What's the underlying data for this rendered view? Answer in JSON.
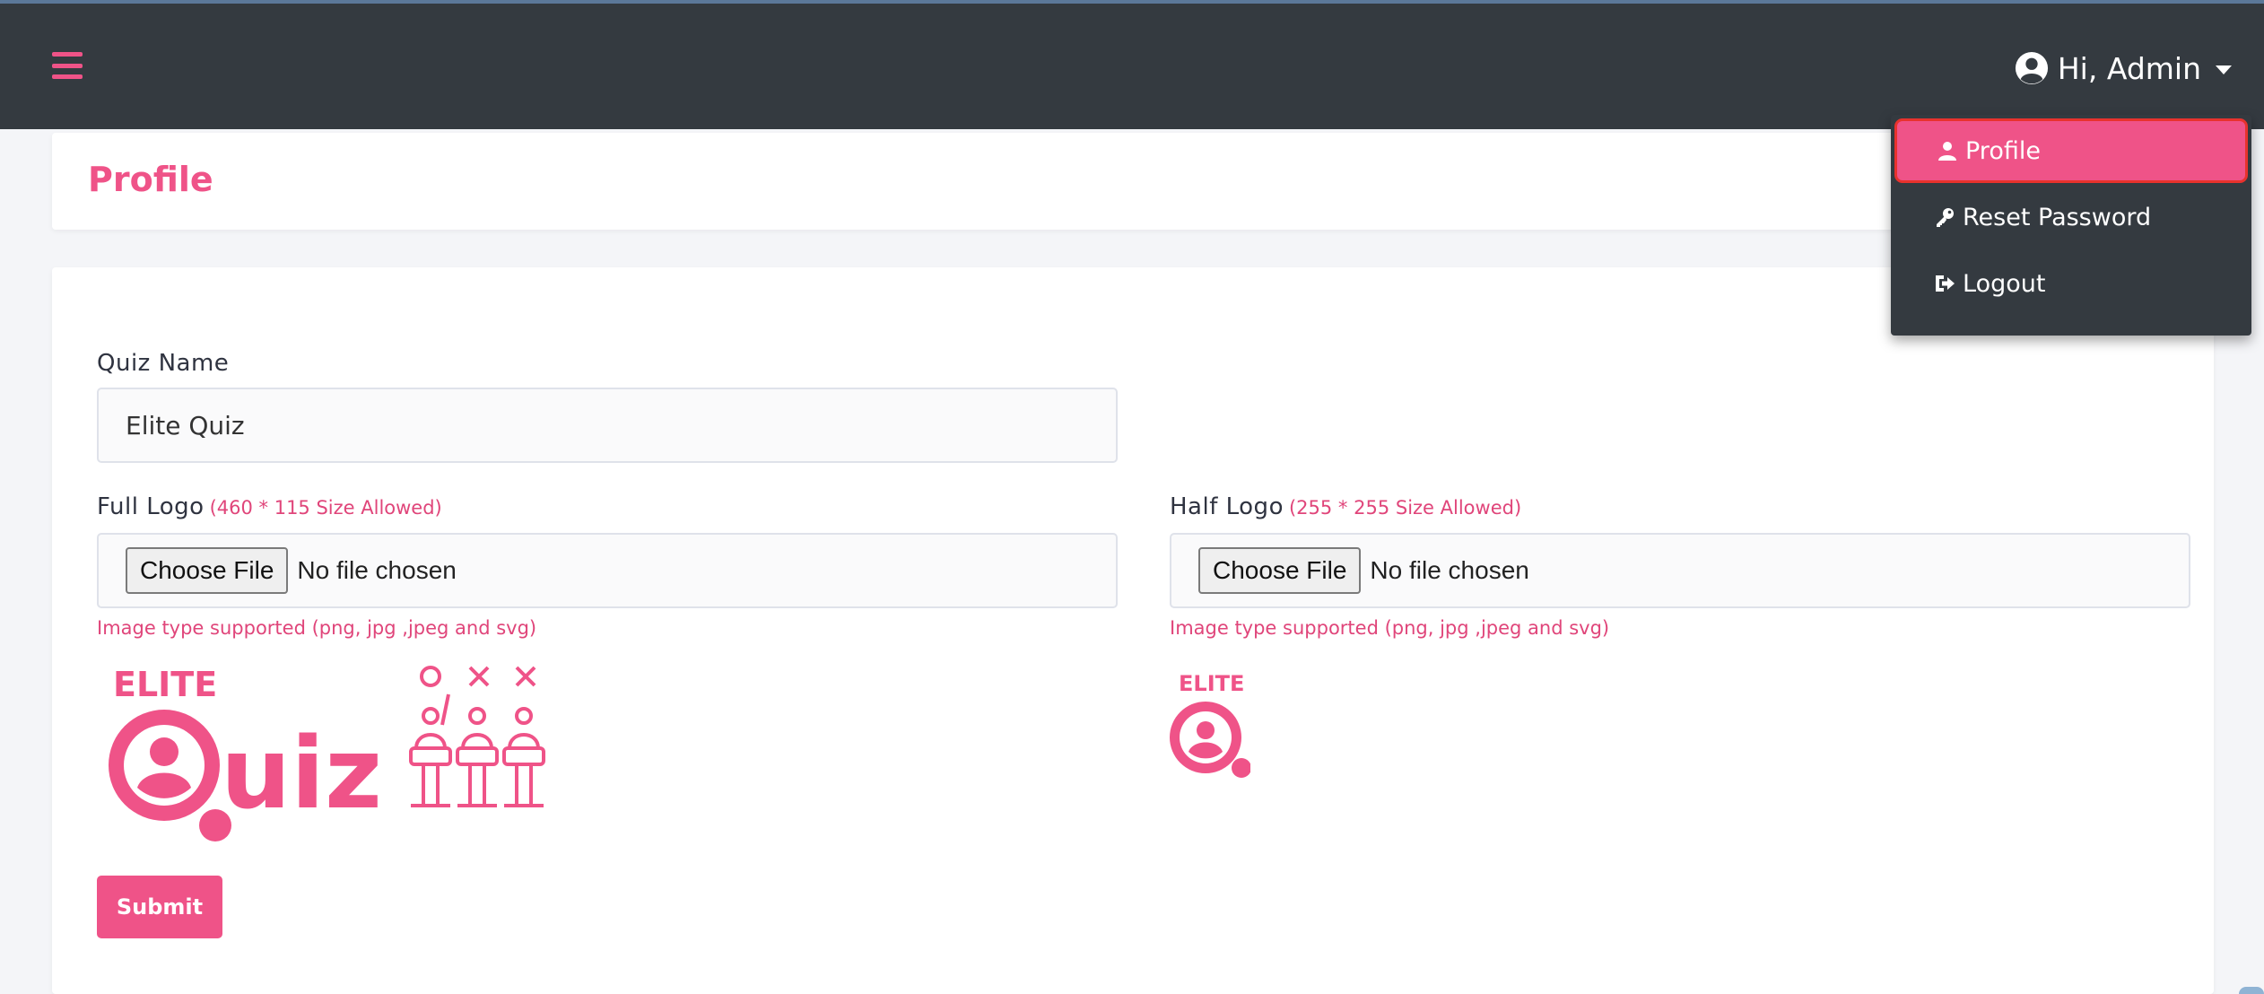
{
  "navbar": {
    "menu_icon": "hamburger-menu-icon",
    "user_greeting": "Hi, Admin",
    "user_icon": "user-circle-icon"
  },
  "dropdown": {
    "items": [
      {
        "label": "Profile",
        "icon": "user-icon"
      },
      {
        "label": "Reset Password",
        "icon": "key-icon"
      },
      {
        "label": "Logout",
        "icon": "logout-icon"
      }
    ]
  },
  "page": {
    "title": "Profile"
  },
  "form": {
    "quiz_name_label": "Quiz Name",
    "quiz_name_value": "Elite Quiz",
    "full_logo_label": "Full Logo",
    "full_logo_hint": "(460 * 115 Size Allowed)",
    "half_logo_label": "Half Logo",
    "half_logo_hint": "(255 * 255 Size Allowed)",
    "choose_file": "Choose File",
    "no_file": "No file chosen",
    "support_text": "Image type supported (png, jpg ,jpeg and svg)",
    "submit_label": "Submit"
  },
  "logos": {
    "full_top": "ELITE",
    "full_word": "uiz",
    "half_top": "ELITE"
  },
  "colors": {
    "accent": "#ef5388",
    "navbar": "#343a40",
    "highlight_border": "#e8322d"
  }
}
